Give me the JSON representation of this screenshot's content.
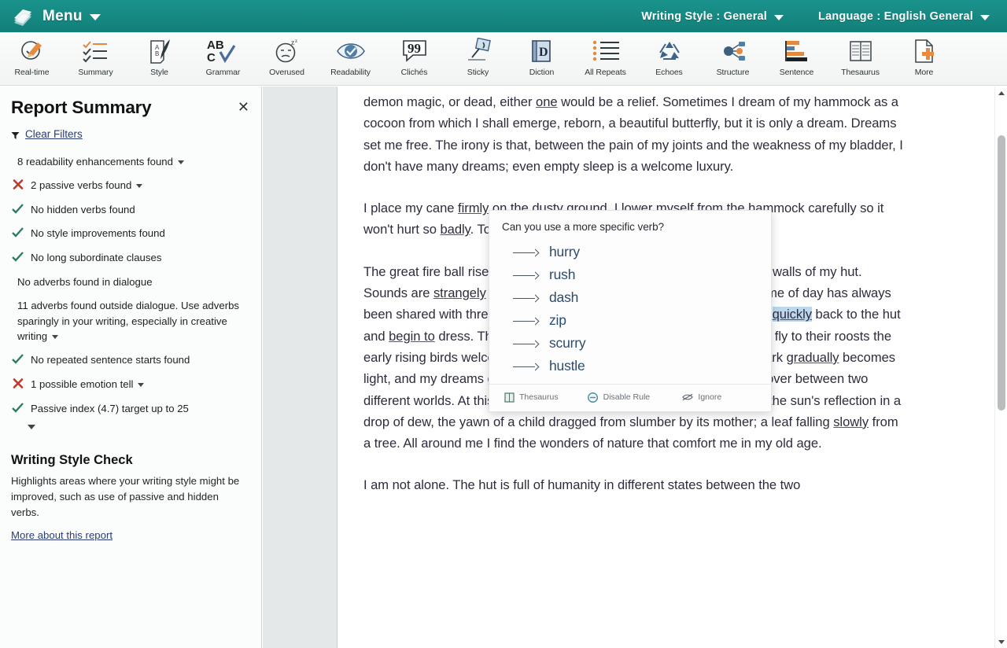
{
  "header": {
    "logo_icon": "prowritingaid-logo-icon",
    "menu_label": "Menu",
    "writing_style": "Writing Style : General",
    "language": "Language : English General"
  },
  "toolbar": {
    "items": [
      {
        "label": "Real-time",
        "icon": "realtime-clock-pen-icon"
      },
      {
        "label": "Summary",
        "icon": "summary-checklist-icon"
      },
      {
        "label": "Style",
        "icon": "style-quill-scroll-icon"
      },
      {
        "label": "Grammar",
        "icon": "grammar-abc-check-icon"
      },
      {
        "label": "Overused",
        "icon": "overused-face-icon"
      },
      {
        "label": "Readability",
        "icon": "readability-eye-check-icon"
      },
      {
        "label": "Clichés",
        "icon": "cliches-quote-bubble-icon"
      },
      {
        "label": "Sticky",
        "icon": "sticky-glue-icon"
      },
      {
        "label": "Diction",
        "icon": "diction-dictionary-icon"
      },
      {
        "label": "All Repeats",
        "icon": "all-repeats-list-icon"
      },
      {
        "label": "Echoes",
        "icon": "echoes-recycle-icon"
      },
      {
        "label": "Structure",
        "icon": "structure-nodes-icon"
      },
      {
        "label": "Sentence",
        "icon": "sentence-bars-icon"
      },
      {
        "label": "Thesaurus",
        "icon": "thesaurus-book-icon"
      },
      {
        "label": "More",
        "icon": "more-page-plus-icon"
      }
    ]
  },
  "sidebar": {
    "title": "Report Summary",
    "close_icon": "close-icon",
    "clear_filters": "Clear Filters",
    "filter_icon": "funnel-icon",
    "items": [
      {
        "mark": "none",
        "text": "8 readability enhancements found",
        "caret": true
      },
      {
        "mark": "cross",
        "text": "2 passive verbs found",
        "caret": true
      },
      {
        "mark": "check",
        "text": "No hidden verbs found",
        "caret": false
      },
      {
        "mark": "check",
        "text": "No style improvements found",
        "caret": false
      },
      {
        "mark": "check",
        "text": "No long subordinate clauses",
        "caret": false
      },
      {
        "mark": "none",
        "text": "No adverbs found in dialogue",
        "caret": false
      },
      {
        "mark": "none",
        "text": "11 adverbs found outside dialogue. Use adverbs sparingly in your writing, especially in creative writing",
        "caret": true
      },
      {
        "mark": "check",
        "text": "No repeated sentence starts found",
        "caret": false
      },
      {
        "mark": "cross",
        "text": "1 possible emotion tell",
        "caret": true
      },
      {
        "mark": "check",
        "text": "Passive index (4.7) target up to 25",
        "caret": false
      }
    ],
    "expand_caret_icon": "chevron-down-icon",
    "subsection": {
      "title": "Writing Style Check",
      "body": "Highlights areas where your writing style might be improved, such as use of passive and hidden verbs.",
      "link": "More about this report"
    }
  },
  "popup": {
    "question": "Can you use a more specific verb?",
    "suggestions": [
      "hurry",
      "rush",
      "dash",
      "zip",
      "scurry",
      "hustle"
    ],
    "footer": [
      {
        "label": "Thesaurus",
        "icon": "thesaurus-book-icon"
      },
      {
        "label": "Disable Rule",
        "icon": "disable-rule-icon"
      },
      {
        "label": "Ignore",
        "icon": "ignore-eye-slash-icon"
      }
    ]
  },
  "document": {
    "paragraphs": [
      {
        "id": "p1",
        "runs": [
          {
            "t": "demon magic, or dead, either "
          },
          {
            "t": "one",
            "style": "underline"
          },
          {
            "t": " would be a relief. Sometimes I dream of my hammock as a cocoon from which I shall emerge, reborn, a beautiful butterfly, but it is only a dream. Dreams set me free. The irony is that, between the pain of my joints and the weakness of my bladder, I don't have many dreams; even empty sleep is a welcome luxury."
          }
        ]
      },
      {
        "id": "p2",
        "runs": [
          {
            "t": "I place my cane "
          },
          {
            "t": "firmly",
            "style": "underline"
          },
          {
            "t": " on the dusty ground, I lower myself from the hammock carefully so it won't hurt so "
          },
          {
            "t": "badly",
            "style": "underline"
          },
          {
            "t": ". Today won't be too bad, I am optimistic."
          }
        ]
      },
      {
        "id": "p3",
        "runs": [
          {
            "t": "The great fire ball rises in the east and splinters of light pierce the leafy walls of my hut. Sounds are "
          },
          {
            "t": "strangely",
            "style": "underline"
          },
          {
            "t": " subdued. Half awake or half asleep for me this time of day has always been shared with three people: my mother, my daugher and me. I walk "
          },
          {
            "t": "quickly",
            "style": "highlight"
          },
          {
            "t": " back to the hut and "
          },
          {
            "t": "begin to",
            "style": "underline"
          },
          {
            "t": " dress. This is the time when all things change. As the bats fly to their roosts the early rising birds welcome the dawn with their "
          },
          {
            "t": "softly",
            "style": "underline"
          },
          {
            "t": " chirped fanfare. Dark "
          },
          {
            "t": "gradually",
            "style": "underline"
          },
          {
            "t": " becomes light, and my dreams give way to consciousness. Its the magical crossover between two different worlds. At this time of day I can find joy in the simplest things: the sun's reflection in a drop of dew, the yawn of a child dragged from slumber by its mother; a leaf falling "
          },
          {
            "t": "slowly",
            "style": "underline"
          },
          {
            "t": " from a tree. All around me I find the wonders of nature that comfort me in my old age."
          }
        ]
      },
      {
        "id": "p4",
        "runs": [
          {
            "t": "I am not alone. The hut is full of humanity in different states between the two"
          }
        ]
      }
    ]
  },
  "scrollbar": {
    "up_icon": "scroll-up-arrow-icon",
    "down_icon": "scroll-down-arrow-icon",
    "thumb_name": "vertical-scroll-thumb"
  },
  "colors": {
    "brand_teal": "#138a84",
    "link_blue": "#2a3c73",
    "suggestion_blue": "#2b4b70",
    "highlight_blue": "#bcd8ef",
    "check_green": "#2f7d5c",
    "cross_red": "#c0392b",
    "doc_text": "#302b3c"
  }
}
